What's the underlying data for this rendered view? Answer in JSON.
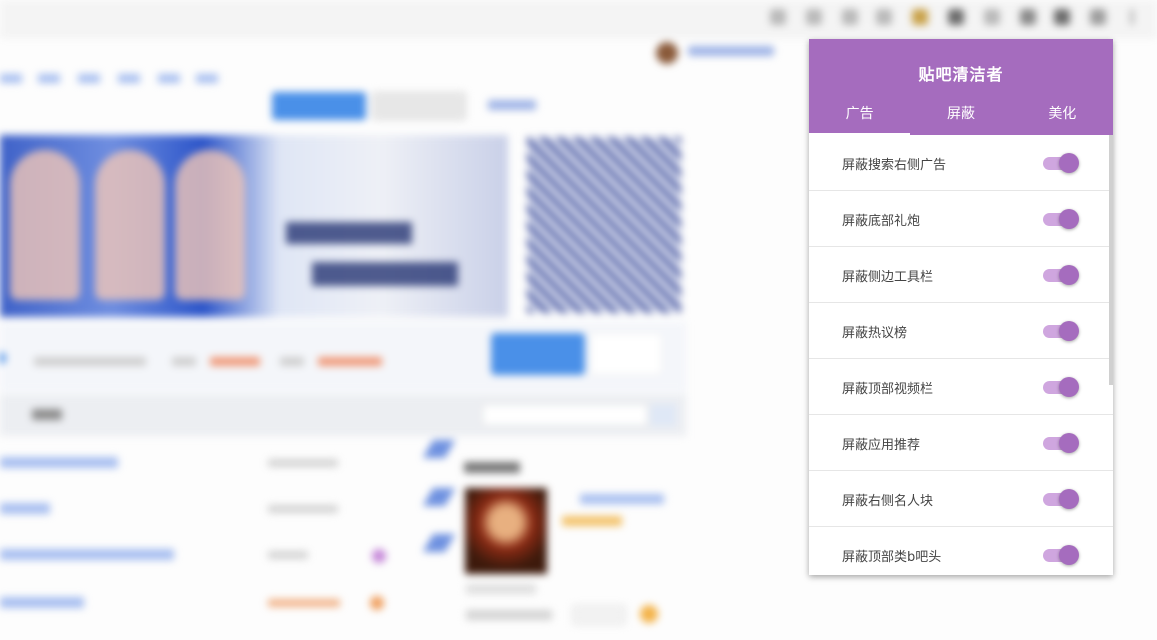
{
  "popup": {
    "title": "贴吧清洁者",
    "accent_color": "#a56cbe",
    "tabs": [
      {
        "label": "广告",
        "active": true
      },
      {
        "label": "屏蔽",
        "active": false
      },
      {
        "label": "美化",
        "active": false
      }
    ],
    "options": [
      {
        "label": "屏蔽搜索右侧广告",
        "enabled": true
      },
      {
        "label": "屏蔽底部礼炮",
        "enabled": true
      },
      {
        "label": "屏蔽侧边工具栏",
        "enabled": true
      },
      {
        "label": "屏蔽热议榜",
        "enabled": true
      },
      {
        "label": "屏蔽顶部视频栏",
        "enabled": true
      },
      {
        "label": "屏蔽应用推荐",
        "enabled": true
      },
      {
        "label": "屏蔽右侧名人块",
        "enabled": true
      },
      {
        "label": "屏蔽顶部类b吧头",
        "enabled": true
      }
    ]
  },
  "background_page": {
    "note_blurred": true
  }
}
